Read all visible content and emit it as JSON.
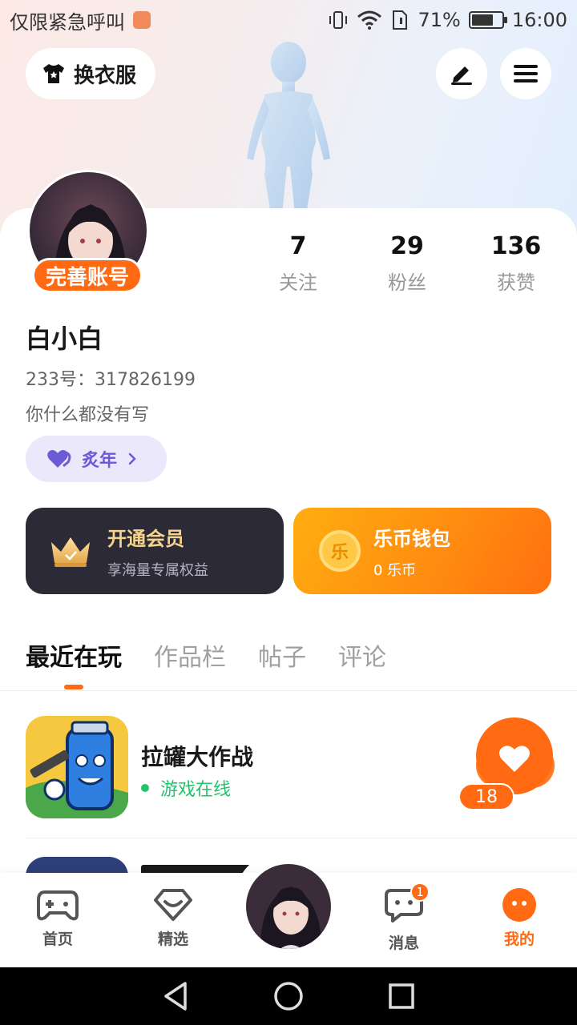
{
  "status_bar": {
    "left_text": "仅限紧急呼叫",
    "battery_text": "71%",
    "battery_level": 0.71,
    "time": "16:00"
  },
  "header": {
    "outfit_button_label": "换衣服",
    "edit_icon": "pencil-icon",
    "menu_icon": "hamburger-menu-icon"
  },
  "profile": {
    "complete_account_label": "完善账号",
    "username": "白小白",
    "uid_text": "233号：317826199",
    "bio": "你什么都没有写",
    "tag_label": "炙年",
    "stats": [
      {
        "value": "7",
        "label": "关注"
      },
      {
        "value": "29",
        "label": "粉丝"
      },
      {
        "value": "136",
        "label": "获赞"
      }
    ]
  },
  "promos": {
    "vip": {
      "title": "开通会员",
      "subtitle": "享海量专属权益"
    },
    "wallet": {
      "title": "乐币钱包",
      "subtitle": "0 乐币",
      "coin_glyph": "乐"
    }
  },
  "tabs": [
    {
      "label": "最近在玩",
      "active": true
    },
    {
      "label": "作品栏",
      "active": false
    },
    {
      "label": "帖子",
      "active": false
    },
    {
      "label": "评论",
      "active": false
    }
  ],
  "recent_games": [
    {
      "title": "拉罐大作战",
      "status": "游戏在线",
      "likes": "18"
    }
  ],
  "bottom_nav": {
    "items": [
      {
        "label": "首页",
        "icon": "gamepad-icon"
      },
      {
        "label": "精选",
        "icon": "heart-diamond-icon"
      },
      {
        "label": "消息",
        "icon": "chat-bubble-icon",
        "badge": "1"
      },
      {
        "label": "我的",
        "icon": "profile-dots-icon",
        "active": true
      }
    ]
  },
  "colors": {
    "accent": "#ff6a13",
    "online_green": "#23c46b",
    "vip_card": "#2b2a36",
    "tag_purple": "#6b5bd6"
  }
}
